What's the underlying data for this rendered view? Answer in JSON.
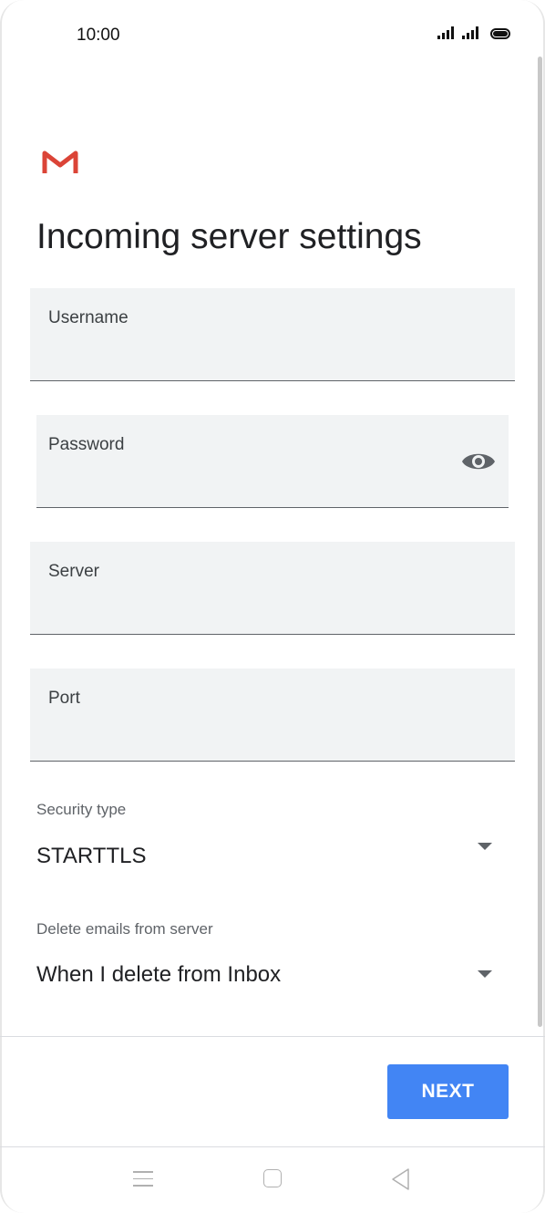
{
  "status_bar": {
    "time": "10:00"
  },
  "page": {
    "title": "Incoming server settings"
  },
  "fields": {
    "username": {
      "label": "Username",
      "value": ""
    },
    "password": {
      "label": "Password",
      "value": ""
    },
    "server": {
      "label": "Server",
      "value": ""
    },
    "port": {
      "label": "Port",
      "value": ""
    }
  },
  "security_type": {
    "label": "Security type",
    "value": "STARTTLS"
  },
  "delete_emails": {
    "label": "Delete emails from server",
    "value": "When I delete from Inbox"
  },
  "actions": {
    "next_label": "NEXT"
  },
  "colors": {
    "accent": "#4285f4",
    "gmail_red": "#db4437",
    "field_bg": "#f1f3f4"
  },
  "icons": [
    "gmail-logo-icon",
    "eye-icon",
    "chevron-down-icon",
    "menu-icon",
    "home-icon",
    "back-icon"
  ]
}
